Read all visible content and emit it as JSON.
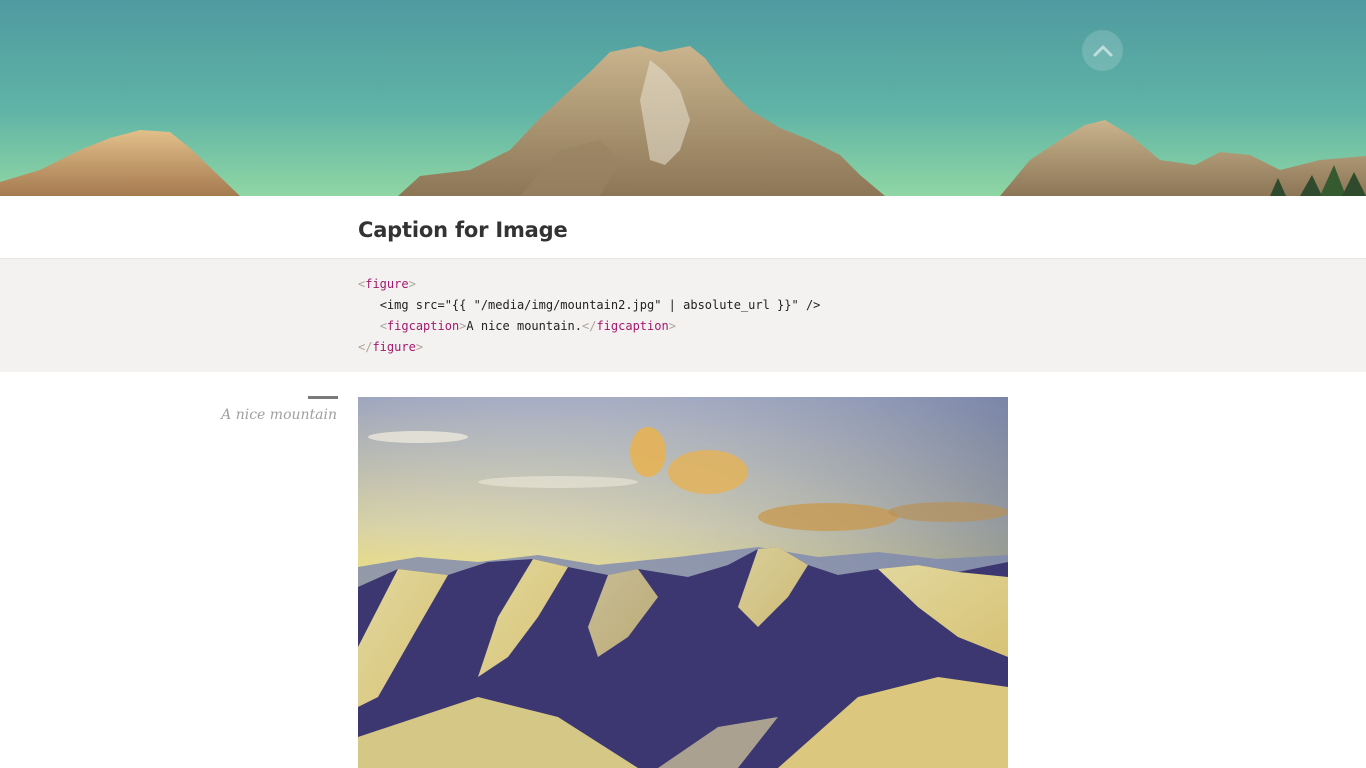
{
  "hero": {
    "image_name": "mountain-panorama",
    "scroll_top_icon": "chevron-up-icon"
  },
  "page": {
    "title": "Caption for Image"
  },
  "code": {
    "line1_tag": "figure",
    "line2_text": "<img src=\"{{ \"/media/img/mountain2.jpg\" | absolute_url }}\" />",
    "line3_open_tag": "figcaption",
    "line3_text": "A nice mountain.",
    "line3_close_tag": "figcaption",
    "line4_tag": "figure",
    "colors": {
      "tag": "#a3186d",
      "bracket": "#b0a49a",
      "text": "#222222"
    }
  },
  "figure": {
    "caption": "A nice mountain",
    "image_name": "snowy-mountains-sunset"
  }
}
